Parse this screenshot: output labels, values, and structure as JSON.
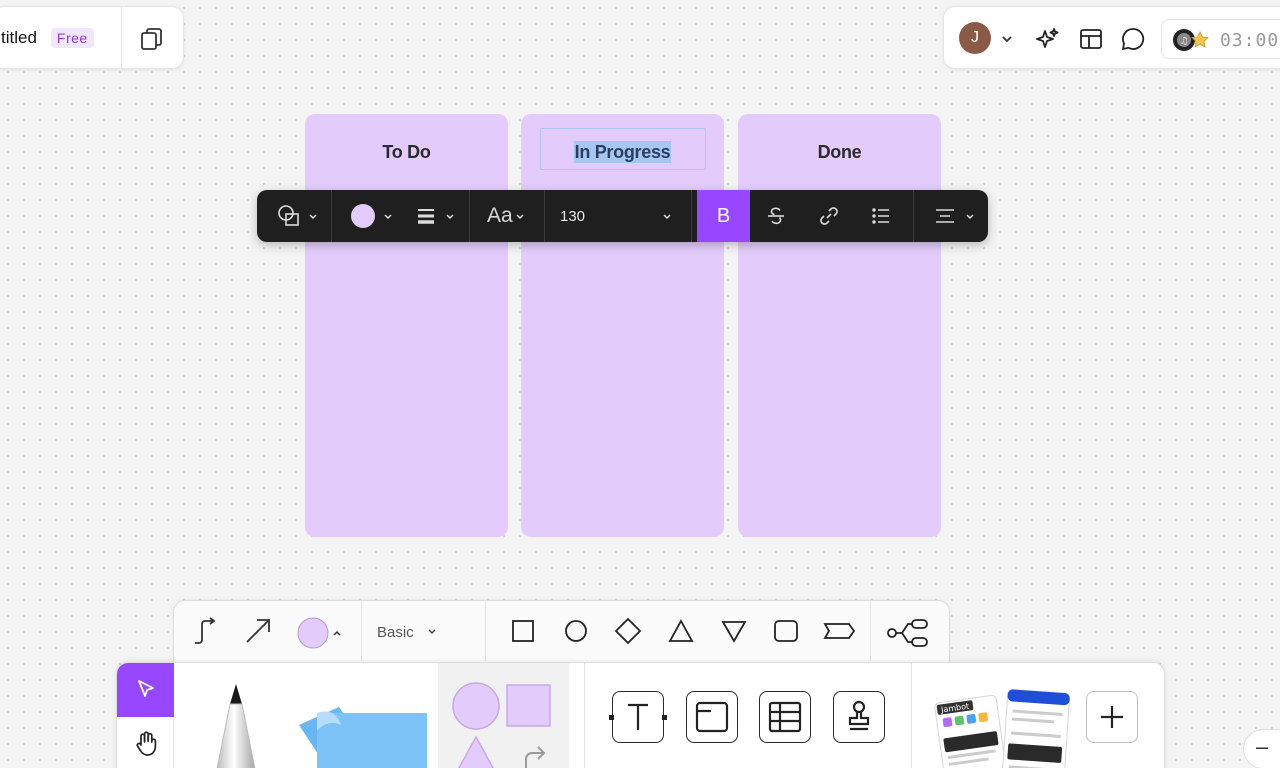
{
  "header": {
    "title": "titled",
    "plan_badge": "Free",
    "duplicate_icon": "duplicate-pages-icon"
  },
  "top_right": {
    "avatar_initial": "J",
    "icons": [
      "chevron-down-icon",
      "ai-sparkle-icon",
      "layout-icon",
      "comment-icon",
      "music-icon"
    ],
    "timer": "03:00"
  },
  "board": {
    "columns": [
      {
        "title": "To Do"
      },
      {
        "title": "In Progress"
      },
      {
        "title": "Done"
      }
    ],
    "column_color": "#e3ccfc"
  },
  "format_toolbar": {
    "font_label": "Aa",
    "font_size": "130",
    "bold_label": "B",
    "fill_color": "#e3ccfc",
    "accent": "#9747ff"
  },
  "shape_toolbar": {
    "style_label": "Basic",
    "shapes": [
      "rectangle",
      "circle",
      "diamond",
      "triangle",
      "inverted-triangle",
      "rounded-rectangle",
      "tag"
    ]
  },
  "main_toolbar": {
    "tools": [
      "select-tool",
      "hand-tool",
      "pen-tool",
      "sticky-note-tool",
      "shapes-tool",
      "text-tool",
      "section-tool",
      "table-tool",
      "stamp-tool",
      "templates",
      "add-more"
    ],
    "template_label": "Jambot"
  },
  "zoom": {
    "out_label": "–"
  }
}
